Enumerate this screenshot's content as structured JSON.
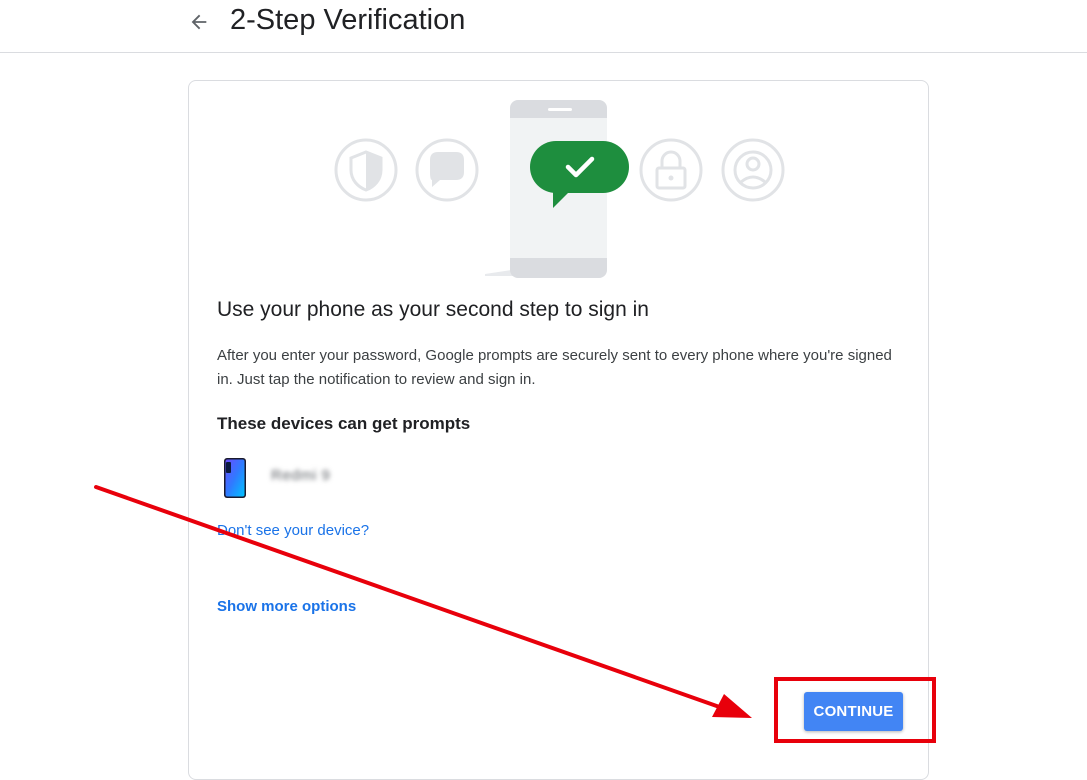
{
  "header": {
    "title": "2-Step Verification",
    "back_icon": "arrow-back-icon"
  },
  "card": {
    "heading": "Use your phone as your second step to sign in",
    "description": "After you enter your password, Google prompts are securely sent to every phone where you're signed in. Just tap the notification to review and sign in.",
    "devices_heading": "These devices can get prompts",
    "devices": [
      {
        "name": "Redmi 9",
        "icon": "smartphone-icon"
      }
    ],
    "dont_see_device_link": "Don't see your device?",
    "show_more_options_link": "Show more options",
    "continue_label": "CONTINUE"
  },
  "hero_icons": [
    "shield-icon",
    "chat-bubble-icon",
    "phone-icon",
    "checkmark-icon",
    "lock-icon",
    "account-icon"
  ],
  "colors": {
    "accent_blue": "#1a73e8",
    "button_blue": "#4285f4",
    "success_green": "#1e8e3e",
    "annotation_red": "#e8000b",
    "icon_gray": "#dadce0"
  }
}
